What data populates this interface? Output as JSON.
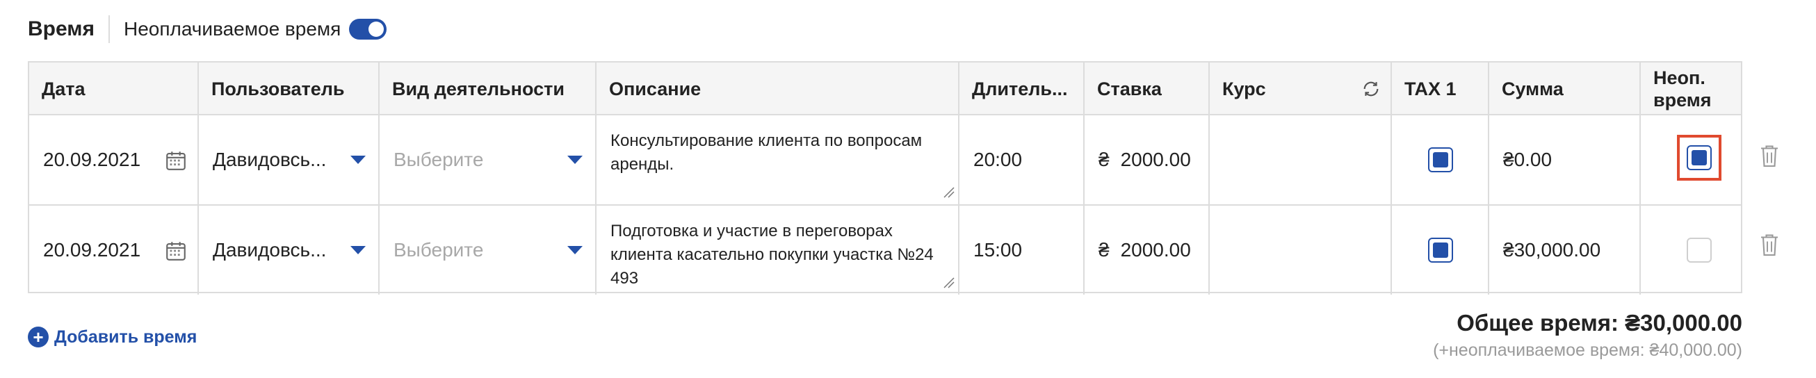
{
  "header": {
    "title": "Время",
    "toggle_label": "Неоплачиваемое время",
    "toggle_on": true
  },
  "table": {
    "columns": {
      "date": "Дата",
      "user": "Пользователь",
      "activity": "Вид деятельности",
      "description": "Описание",
      "duration": "Длитель...",
      "rate": "Ставка",
      "exchange": "Курс",
      "tax1": "TAX 1",
      "amount": "Сумма",
      "unpaid_line1": "Неоп.",
      "unpaid_line2": "время"
    },
    "rows": [
      {
        "date": "20.09.2021",
        "user": "Давидовсь...",
        "activity_placeholder": "Выберите",
        "description": "Консультирование клиента по вопросам аренды.",
        "duration": "20:00",
        "rate_symbol": "₴",
        "rate_value": "2000.00",
        "exchange": "",
        "tax1_checked": true,
        "amount": "₴0.00",
        "unpaid_checked": true
      },
      {
        "date": "20.09.2021",
        "user": "Давидовсь...",
        "activity_placeholder": "Выберите",
        "description": "Подготовка и участие в переговорах клиента касательно покупки участка №24 493",
        "duration": "15:00",
        "rate_symbol": "₴",
        "rate_value": "2000.00",
        "exchange": "",
        "tax1_checked": true,
        "amount": "₴30,000.00",
        "unpaid_checked": false
      }
    ]
  },
  "footer": {
    "add_time_label": "Добавить время",
    "total": "Общее время: ₴30,000.00",
    "unpaid_total": "(+неоплачиваемое время: ₴40,000.00)"
  },
  "colors": {
    "accent": "#2350a8",
    "highlight": "#e04a2f",
    "border": "#dcdcdc",
    "header_bg": "#f5f5f5"
  }
}
